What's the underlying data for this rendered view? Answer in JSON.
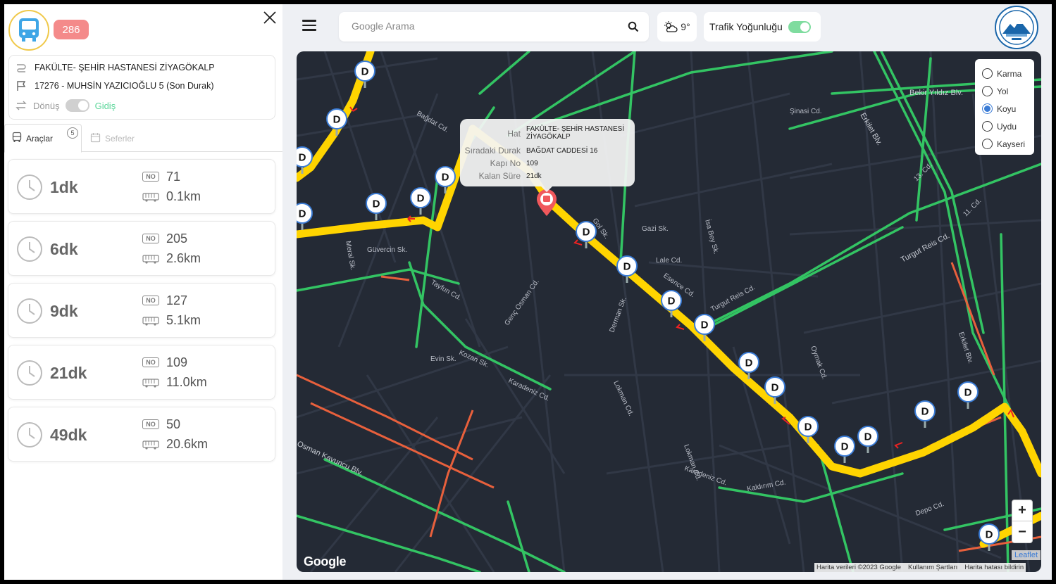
{
  "line": {
    "number": "286"
  },
  "route": {
    "line_name": "FAKÜLTE- ŞEHİR HASTANESİ ZİYAGÖKALP",
    "last_stop": "17276 - MUHSİN YAZICIOĞLU 5 (Son Durak)",
    "direction_back": "Dönüş",
    "direction_go": "Gidiş"
  },
  "tabs": {
    "vehicles": "Araçlar",
    "vehicles_count": "5",
    "trips": "Seferler"
  },
  "vehicles": [
    {
      "time": "1dk",
      "no_label": "NO",
      "no": "71",
      "distance": "0.1km"
    },
    {
      "time": "6dk",
      "no_label": "NO",
      "no": "205",
      "distance": "2.6km"
    },
    {
      "time": "9dk",
      "no_label": "NO",
      "no": "127",
      "distance": "5.1km"
    },
    {
      "time": "21dk",
      "no_label": "NO",
      "no": "109",
      "distance": "11.0km"
    },
    {
      "time": "49dk",
      "no_label": "NO",
      "no": "50",
      "distance": "20.6km"
    }
  ],
  "search": {
    "placeholder": "Google Arama"
  },
  "weather": {
    "temp": "9°"
  },
  "traffic": {
    "label": "Trafik Yoğunluğu"
  },
  "map_layers": {
    "options": [
      "Karma",
      "Yol",
      "Koyu",
      "Uydu",
      "Kayseri"
    ],
    "selected": "Koyu"
  },
  "popup": {
    "hat_label": "Hat",
    "hat": "FAKÜLTE- ŞEHİR HASTANESİ ZİYAGÖKALP",
    "stop_label": "Sıradaki Durak",
    "stop": "BAĞDAT CADDESİ 16",
    "door_label": "Kapı No",
    "door": "109",
    "remaining_label": "Kalan Süre",
    "remaining": "21dk"
  },
  "zoom": {
    "in": "+",
    "out": "−"
  },
  "attribution": {
    "leaflet": "Leaflet",
    "data": "Harita verileri ©2023 Google",
    "terms": "Kullanım Şartları",
    "report": "Harita hatası bildirin",
    "google": "Google"
  },
  "stop_marker_letter": "D",
  "colors": {
    "route": "#ffd400",
    "traffic_free": "#33c463",
    "traffic_slow": "#e8603c",
    "map_bg": "#242a35",
    "accent_green": "#5cd69a"
  },
  "street_labels": [
    "Bağdat Cd.",
    "Bekir Yıldız Blv.",
    "Şinasi Cd.",
    "Turgut Reis Cd.",
    "Esence Cd.",
    "Erkilet Blv.",
    "Osman Kavuncu Blv.",
    "Karadeniz Cd.",
    "Lokman Cd.",
    "Genç Osman Cd.",
    "Oymak Cd.",
    "Kaldırım Cd.",
    "Tayfun Cd.",
    "Derman Sk.",
    "İsa Bey Sk.",
    "Depo Cd.",
    "13. Cd.",
    "11. Cd.",
    "Kozan Sk.",
    "Evin Sk.",
    "Gazi Sk.",
    "Gol Sk.",
    "Lale Cd.",
    "Güvercin Sk.",
    "Meral Sk."
  ]
}
